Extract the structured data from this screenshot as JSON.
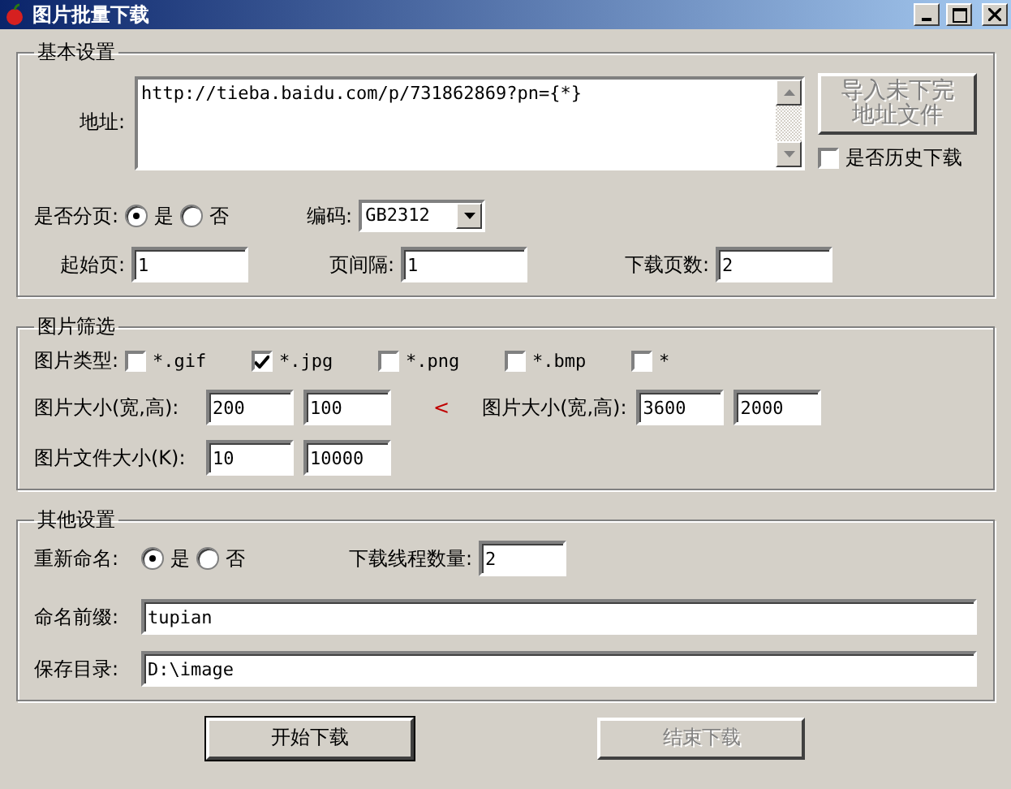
{
  "window": {
    "title": "图片批量下载"
  },
  "basic": {
    "legend": "基本设置",
    "address_label": "地址:",
    "address": "http://tieba.baidu.com/p/731862869?pn={*}",
    "import_button": {
      "lines": [
        "导入未下完",
        "地址文件"
      ],
      "disabled": true
    },
    "history": {
      "label": "是否历史下载",
      "checked": false
    },
    "paging_label": "是否分页:",
    "paging": [
      {
        "label": "是",
        "selected": true
      },
      {
        "label": "否",
        "selected": false
      }
    ],
    "encoding_label": "编码:",
    "encoding": "GB2312",
    "fields": [
      {
        "label": "起始页:",
        "value": "1"
      },
      {
        "label": "页间隔:",
        "value": "1"
      },
      {
        "label": "下载页数:",
        "value": "2"
      }
    ]
  },
  "filter": {
    "legend": "图片筛选",
    "types_label": "图片类型:",
    "types": [
      {
        "label": "*.gif",
        "checked": false
      },
      {
        "label": "*.jpg",
        "checked": true
      },
      {
        "label": "*.png",
        "checked": false
      },
      {
        "label": "*.bmp",
        "checked": false
      },
      {
        "label": "*",
        "checked": false
      }
    ],
    "min_size_label": "图片大小(宽,高):",
    "min_size": [
      "200",
      "100"
    ],
    "separator": "<",
    "max_size_label": "图片大小(宽,高):",
    "max_size": [
      "3600",
      "2000"
    ],
    "file_size_label": "图片文件大小(K):",
    "file_size": [
      "10",
      "10000"
    ]
  },
  "other": {
    "legend": "其他设置",
    "rename_label": "重新命名:",
    "rename": [
      {
        "label": "是",
        "selected": true
      },
      {
        "label": "否",
        "selected": false
      }
    ],
    "threads_label": "下载线程数量:",
    "threads": "2",
    "prefix_label": "命名前缀:",
    "prefix": "tupian",
    "dir_label": "保存目录:",
    "dir": "D:\\image"
  },
  "buttons": [
    {
      "label": "开始下载",
      "disabled": false
    },
    {
      "label": "结束下载",
      "disabled": true
    }
  ]
}
